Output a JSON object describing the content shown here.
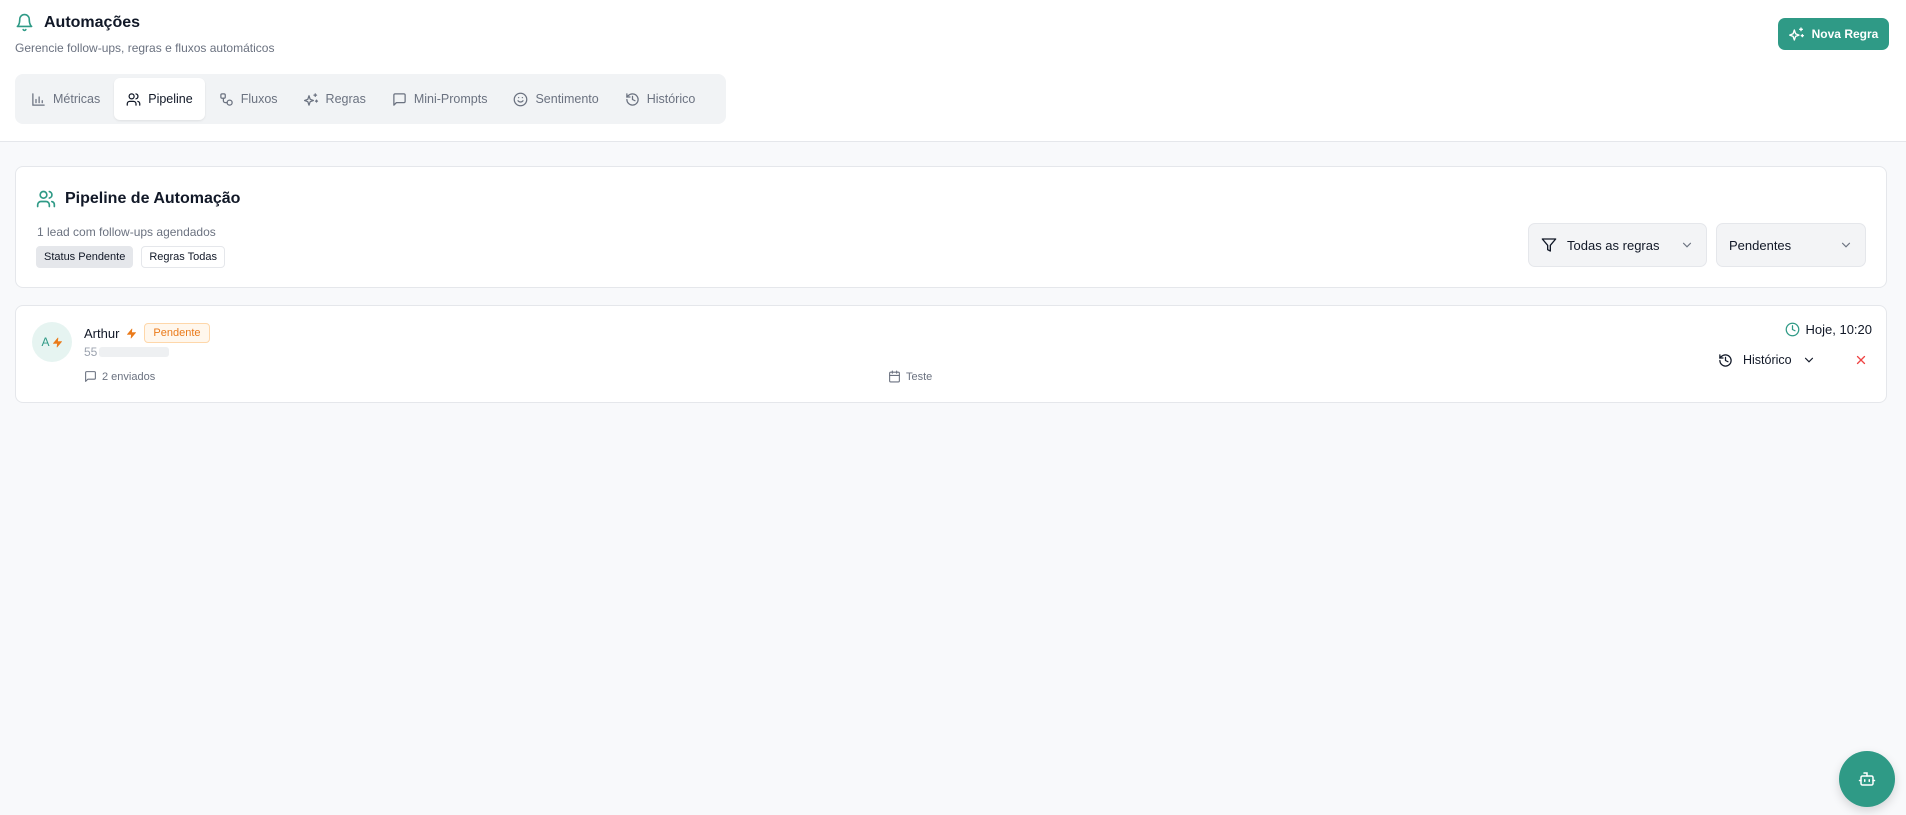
{
  "header": {
    "title": "Automações",
    "subtitle": "Gerencie follow-ups, regras e fluxos automáticos",
    "title_icon": "bell-icon",
    "new_rule_label": "Nova Regra"
  },
  "tabs": [
    {
      "label": "Métricas",
      "icon": "bar-chart-icon",
      "active": false
    },
    {
      "label": "Pipeline",
      "icon": "users-icon",
      "active": true
    },
    {
      "label": "Fluxos",
      "icon": "workflow-icon",
      "active": false
    },
    {
      "label": "Regras",
      "icon": "sparkles-icon",
      "active": false
    },
    {
      "label": "Mini-Prompts",
      "icon": "message-square-icon",
      "active": false
    },
    {
      "label": "Sentimento",
      "icon": "smile-icon",
      "active": false
    },
    {
      "label": "Histórico",
      "icon": "history-icon",
      "active": false
    }
  ],
  "pipeline": {
    "title": "Pipeline de Automação",
    "description": "1 lead com follow-ups agendados",
    "chips": [
      "Status Pendente",
      "Regras Todas"
    ],
    "rules_filter": "Todas as regras",
    "status_filter": "Pendentes"
  },
  "lead": {
    "avatar_initial": "A",
    "name": "Arthur",
    "status": "Pendente",
    "phone_prefix": "55",
    "sent_count": "2 enviados",
    "flow_name": "Teste",
    "scheduled_time": "Hoje, 10:20",
    "history_label": "Histórico"
  },
  "colors": {
    "accent": "#2f9a86",
    "warning": "#ea7a1a",
    "danger": "#ef4444"
  }
}
